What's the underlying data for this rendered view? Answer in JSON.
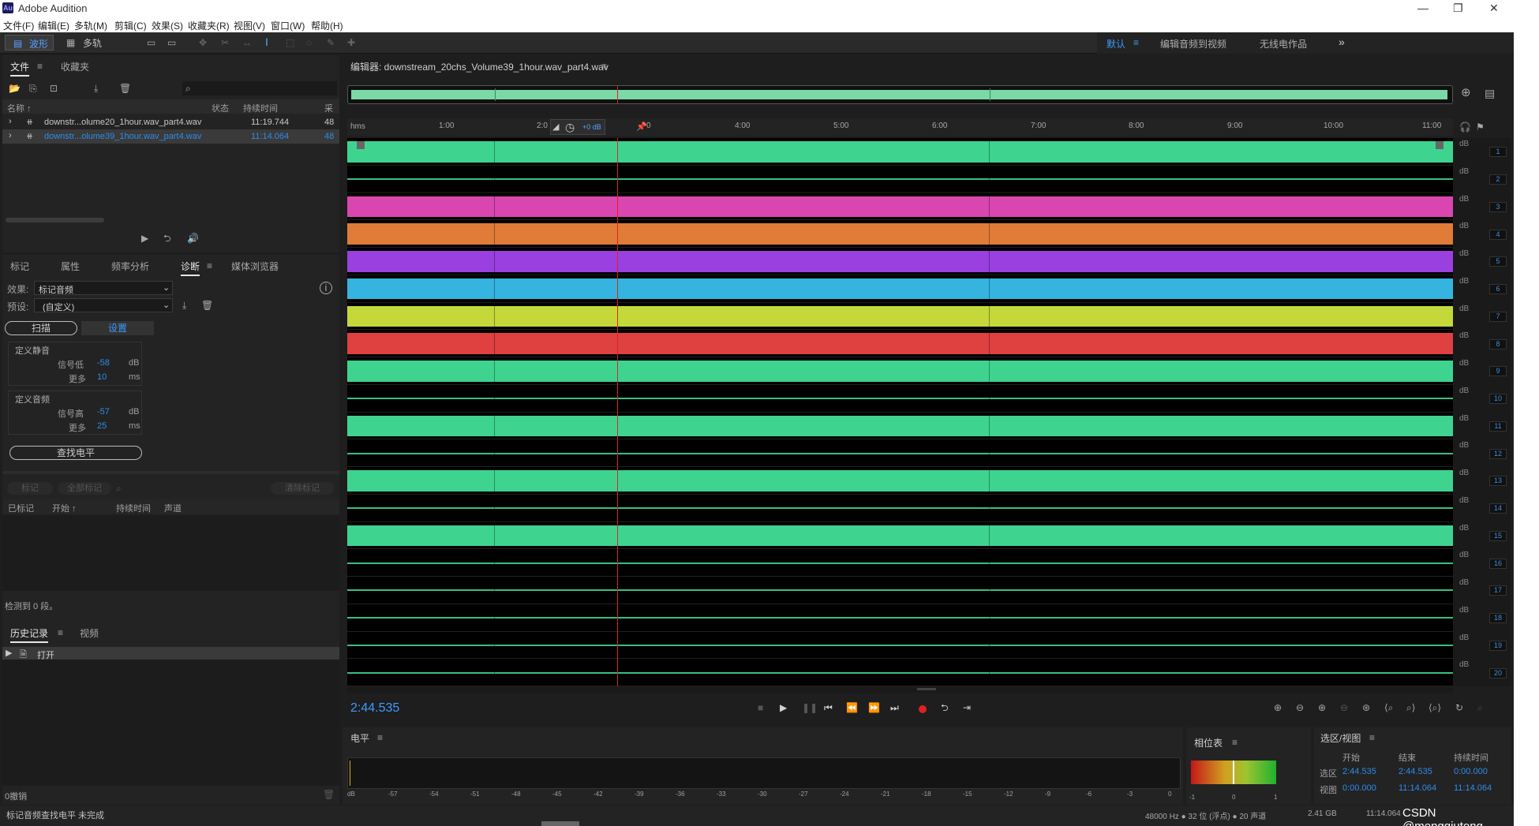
{
  "app": {
    "title": "Adobe Audition",
    "logo_text": "Au"
  },
  "window_controls": {
    "minimize": "—",
    "restore": "❐",
    "close": "✕"
  },
  "menu": [
    "文件(F)",
    "编辑(E)",
    "多轨(M)",
    "剪辑(C)",
    "效果(S)",
    "收藏夹(R)",
    "视图(V)",
    "窗口(W)",
    "帮助(H)"
  ],
  "toolbar": {
    "waveform_label": "波形",
    "multitrack_label": "多轨",
    "workspace_default": "默认",
    "workspace_edit_video": "编辑音频到视频",
    "workspace_radio": "无线电作品",
    "more": "»"
  },
  "files_panel": {
    "tabs": [
      "文件",
      "收藏夹"
    ],
    "columns": {
      "name": "名称 ↑",
      "status": "状态",
      "duration": "持续时间",
      "sample": "采"
    },
    "files": [
      {
        "name": "downstr...olume20_1hour.wav_part4.wav",
        "duration": "11:19.744",
        "sample": "48",
        "selected": false
      },
      {
        "name": "downstr...olume39_1hour.wav_part4.wav",
        "duration": "11:14.064",
        "sample": "48",
        "selected": true
      }
    ]
  },
  "diag_panel": {
    "tabs": [
      "标记",
      "属性",
      "频率分析",
      "诊断",
      "媒体浏览器"
    ],
    "effect_label": "效果:",
    "effect_value": "标记音频",
    "preset_label": "预设:",
    "preset_value": "(自定义)",
    "scan_button": "扫描",
    "settings_button": "设置",
    "silence": {
      "heading": "定义静音",
      "signal_label": "信号低",
      "signal_value": "-58",
      "signal_unit": "dB",
      "more_label": "更多",
      "more_value": "10",
      "more_unit": "ms"
    },
    "audio": {
      "heading": "定义音频",
      "signal_label": "信号高",
      "signal_value": "-57",
      "signal_unit": "dB",
      "more_label": "更多",
      "more_value": "25",
      "more_unit": "ms"
    },
    "find_level_button": "查找电平",
    "mark_button": "标记",
    "mark_all_button": "全部标记",
    "clear_marks_button": "清除标记",
    "table_columns": [
      "已标记",
      "开始 ↑",
      "持续时间",
      "声道"
    ],
    "detected_text": "检测到 0 段。"
  },
  "history_panel": {
    "tabs": [
      "历史记录",
      "视频"
    ],
    "items": [
      "打开"
    ],
    "undo_text": "0撤销"
  },
  "status_bar": {
    "left": "标记音频查找电平 未完成",
    "sample_info": "48000 Hz ● 32 位 (浮点) ● 20 声道",
    "size": "2.41 GB",
    "duration": "11:14.064",
    "watermark": "CSDN @mengqiutong"
  },
  "editor": {
    "title": "编辑器: downstream_20chs_Volume39_1hour.wav_part4.wav",
    "ruler_unit": "hms",
    "ruler_ticks": [
      "1:00",
      "2:0",
      "0",
      "4:00",
      "5:00",
      "6:00",
      "7:00",
      "8:00",
      "9:00",
      "10:00",
      "11:00"
    ],
    "hud_gain": "+0 dB",
    "current_time": "2:44.535",
    "db_label": "dB",
    "channel_count": 20,
    "playhead_fraction": 0.244,
    "channels": [
      {
        "n": "1",
        "color": "#3ed490",
        "full": true
      },
      {
        "n": "2",
        "color": "#3ed490",
        "full": false
      },
      {
        "n": "3",
        "color": "#d946b0",
        "full": true
      },
      {
        "n": "4",
        "color": "#e07c38",
        "full": true
      },
      {
        "n": "5",
        "color": "#9a3fe0",
        "full": true
      },
      {
        "n": "6",
        "color": "#35b4e0",
        "full": true
      },
      {
        "n": "7",
        "color": "#c4d83a",
        "full": true
      },
      {
        "n": "8",
        "color": "#df4040",
        "full": true
      },
      {
        "n": "9",
        "color": "#3ed490",
        "full": true
      },
      {
        "n": "10",
        "color": "#3ed490",
        "full": false
      },
      {
        "n": "11",
        "color": "#3ed490",
        "full": true
      },
      {
        "n": "12",
        "color": "#3ed490",
        "full": false
      },
      {
        "n": "13",
        "color": "#3ed490",
        "full": true
      },
      {
        "n": "14",
        "color": "#3ed490",
        "full": false
      },
      {
        "n": "15",
        "color": "#3ed490",
        "full": true
      },
      {
        "n": "16",
        "color": "#3ed490",
        "full": false
      },
      {
        "n": "17",
        "color": "#3ed490",
        "full": false
      },
      {
        "n": "18",
        "color": "#3ed490",
        "full": false
      },
      {
        "n": "19",
        "color": "#3ed490",
        "full": false
      },
      {
        "n": "20",
        "color": "#3ed490",
        "full": false
      }
    ]
  },
  "level_panel": {
    "title": "电平",
    "scale": [
      "dB",
      "-57",
      "-54",
      "-51",
      "-48",
      "-45",
      "-42",
      "-39",
      "-36",
      "-33",
      "-30",
      "-27",
      "-24",
      "-21",
      "-18",
      "-15",
      "-12",
      "-9",
      "-6",
      "-3",
      "0"
    ]
  },
  "phase_panel": {
    "title": "相位表",
    "scale": [
      "-1",
      "0",
      "1"
    ]
  },
  "selection_panel": {
    "title": "选区/视图",
    "headers": [
      "开始",
      "结束",
      "持续时间"
    ],
    "rows": [
      {
        "label": "选区",
        "start": "2:44.535",
        "end": "2:44.535",
        "duration": "0:00.000"
      },
      {
        "label": "视图",
        "start": "0:00.000",
        "end": "11:14.064",
        "duration": "11:14.064"
      }
    ]
  },
  "colors": {
    "accent_blue": "#2d8ceb",
    "playhead": "#e02020",
    "record": "#e02020"
  }
}
